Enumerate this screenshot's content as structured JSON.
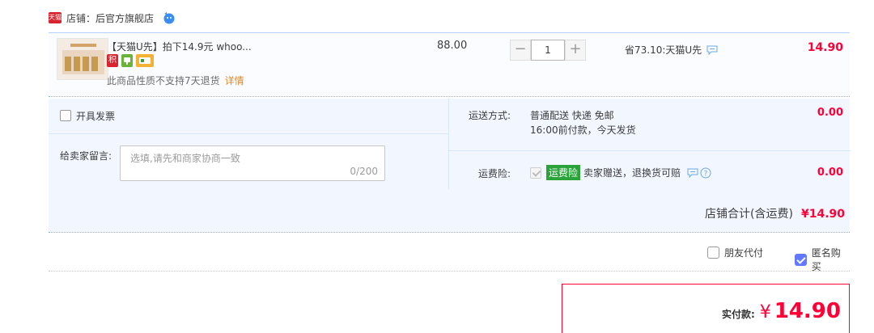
{
  "shop": {
    "logo_text": "天猫",
    "label": "店铺：后官方旗舰店",
    "contact_icon": "wangwang-icon"
  },
  "item": {
    "title": "【天猫U先】拍下14.9元 whoo...",
    "badges": [
      "积",
      "chat-badge-icon",
      "card-icon"
    ],
    "return_note": "此商品性质不支持7天退货",
    "detail_link": "详情",
    "unit_price": "88.00",
    "quantity": "1",
    "qty_minus": "−",
    "qty_plus": "+",
    "discount": "省73.10:天猫U先",
    "total": "14.90"
  },
  "extras": {
    "invoice_label": "开具发票",
    "message_label": "给卖家留言:",
    "message_placeholder": "选填,请先和商家协商一致",
    "message_count": "0/200",
    "shipping_label": "运送方式:",
    "shipping_line1": "普通配送 快递 免邮",
    "shipping_line2": "16:00前付款，今天发货",
    "shipping_fee": "0.00",
    "insurance_label": "运费险:",
    "insurance_badge": "运费险",
    "insurance_text": "卖家赠送，退换货可赔",
    "insurance_fee": "0.00",
    "shop_total_label": "店铺合计(含运费)",
    "shop_total_amount": "¥14.90"
  },
  "options": {
    "friend_pay": "朋友代付",
    "anonymous": "匿名购买"
  },
  "payment": {
    "label": "实付款:",
    "currency": "¥",
    "amount": "14.90"
  },
  "colors": {
    "price_red": "#ff0036",
    "link_orange": "#d98b2b",
    "panel_blue": "#f2f7ff",
    "check_blue": "#6178ff"
  }
}
